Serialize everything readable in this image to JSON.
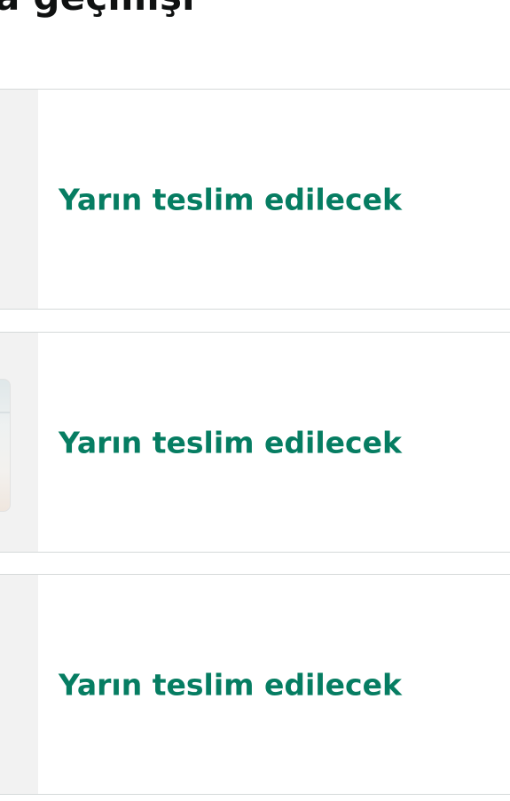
{
  "header": {
    "title": "a geçmişi"
  },
  "orders": [
    {
      "status": "Yarın teslim edilecek",
      "status_color": "#067D62"
    },
    {
      "status": "Yarın teslim edilecek",
      "status_color": "#067D62"
    },
    {
      "status": "Yarın teslim edilecek",
      "status_color": "#067D62"
    }
  ]
}
